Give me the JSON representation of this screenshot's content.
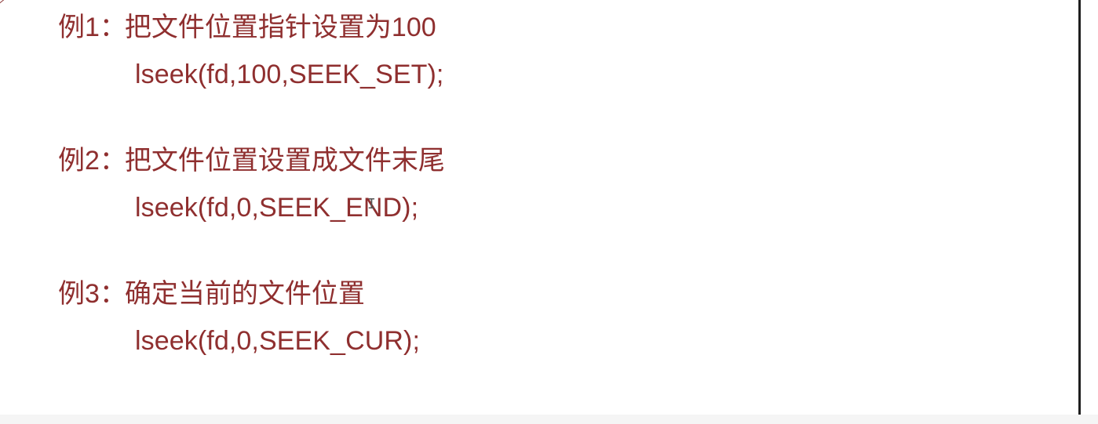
{
  "examples": [
    {
      "label": "例1",
      "colon": "：",
      "description": "把文件位置指针设置为100",
      "code": "lseek(fd,100,SEEK_SET);"
    },
    {
      "label": "例2",
      "colon": "：",
      "description": "把文件位置设置成文件末尾",
      "code": "lseek(fd,0,SEEK_END);"
    },
    {
      "label": "例3",
      "colon": "：",
      "description": "确定当前的文件位置",
      "code": "lseek(fd,0,SEEK_CUR);"
    }
  ],
  "colors": {
    "text": "#8f2f2f",
    "background": "#ffffff",
    "rule": "#1f1f1f"
  },
  "icons": {
    "text_cursor": "text-cursor-icon"
  }
}
